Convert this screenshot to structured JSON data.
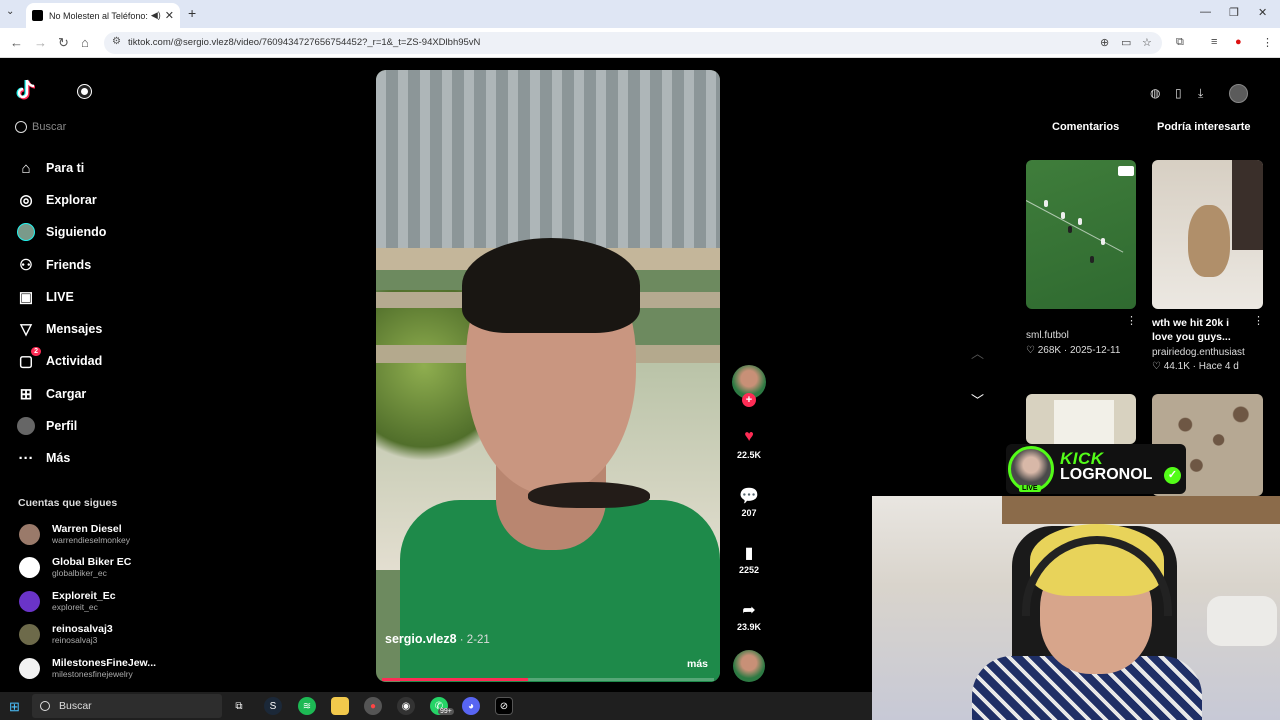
{
  "browser": {
    "tab_title": "No Molesten al Teléfono: Ú",
    "url": "tiktok.com/@sergio.vlez8/video/7609434727656754452?_r=1&_t=ZS-94XDlbh95vN"
  },
  "sidebar": {
    "search_placeholder": "Buscar",
    "nav": [
      {
        "label": "Para ti",
        "icon": "home-icon"
      },
      {
        "label": "Explorar",
        "icon": "compass-icon"
      },
      {
        "label": "Siguiendo",
        "icon": "following-icon"
      },
      {
        "label": "Friends",
        "icon": "friends-icon"
      },
      {
        "label": "LIVE",
        "icon": "live-icon"
      },
      {
        "label": "Mensajes",
        "icon": "messages-icon"
      },
      {
        "label": "Actividad",
        "icon": "activity-icon",
        "badge": "2"
      },
      {
        "label": "Cargar",
        "icon": "upload-icon"
      },
      {
        "label": "Perfil",
        "icon": "profile-icon"
      },
      {
        "label": "Más",
        "icon": "more-icon"
      }
    ],
    "following_title": "Cuentas que sigues",
    "accounts": [
      {
        "name": "Warren Diesel",
        "handle": "warrendieselmonkey"
      },
      {
        "name": "Global Biker EC",
        "handle": "globalbiker_ec"
      },
      {
        "name": "Exploreit_Ec",
        "handle": "exploreit_ec"
      },
      {
        "name": "reinosalvaj3",
        "handle": "reinosalvaj3"
      },
      {
        "name": "MilestonesFineJew...",
        "handle": "milestonesfinejewelry"
      }
    ]
  },
  "video": {
    "username": "sergio.vlez8",
    "date": " · 2-21",
    "more": "más",
    "progress": 0.44
  },
  "actions": {
    "likes": "22.5K",
    "comments": "207",
    "saves": "2252",
    "shares": "23.9K"
  },
  "right_panel": {
    "tabs": [
      "Comentarios",
      "Podría interesarte"
    ],
    "cards": [
      {
        "author": "sml.futbol",
        "likes": "268K",
        "date": "2025-12-11"
      },
      {
        "title": "wth we hit 20k i love you guys...",
        "author": "prairiedog.enthusiast",
        "likes": "44.1K",
        "date": "Hace 4 d"
      }
    ]
  },
  "overlay": {
    "brand": "KICK",
    "channel": "LOGRONOL",
    "live": "LIVE"
  },
  "taskbar": {
    "search_label": "Buscar",
    "badge": "99+"
  },
  "colors": {
    "accent": "#fe2c55",
    "kick_green": "#53fc18"
  }
}
